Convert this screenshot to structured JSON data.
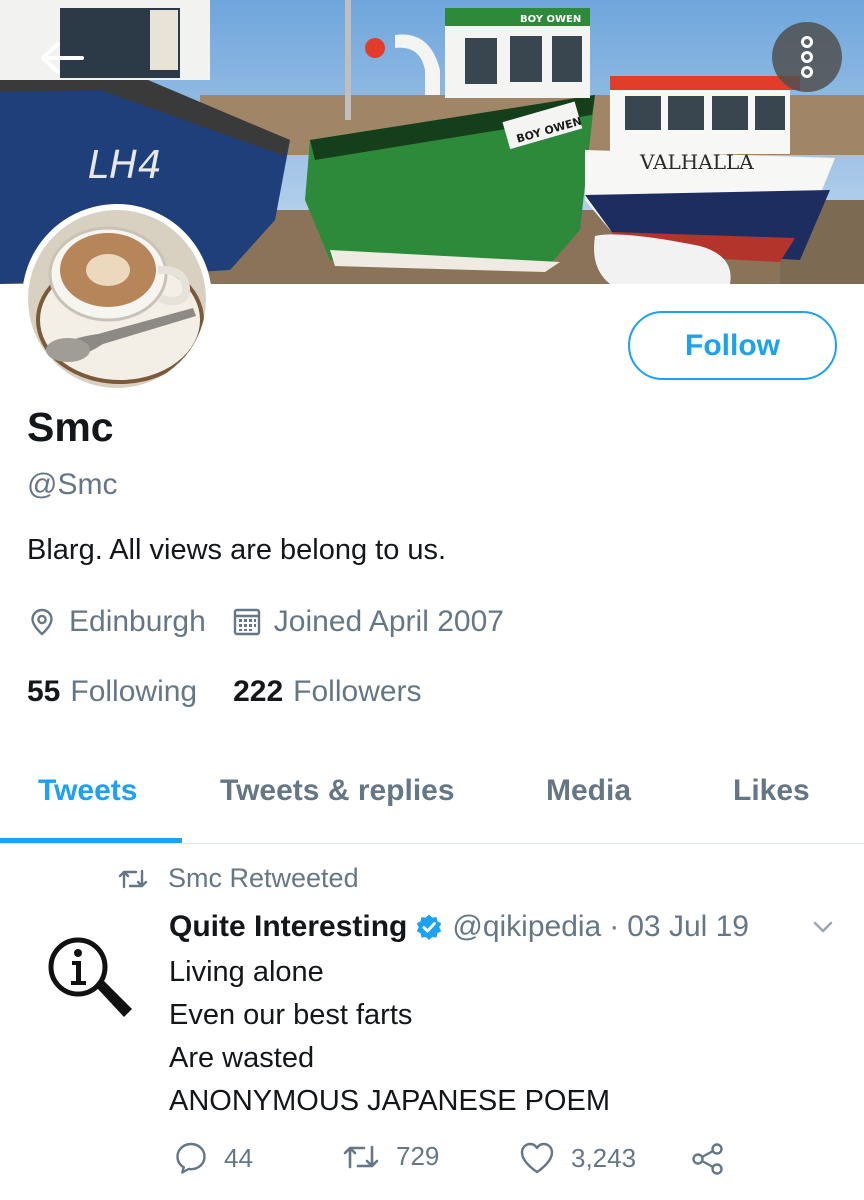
{
  "banner": {
    "boats": [
      {
        "name_hull": "LH4"
      },
      {
        "name_cabin": "BOY OWEN",
        "name_bow": "BOY OWEN"
      },
      {
        "name_hull": "VALHALLA"
      }
    ]
  },
  "header": {
    "back_icon": "arrow-left-icon",
    "more_icon": "more-options-icon"
  },
  "profile": {
    "display_name": "Smc",
    "handle": "@Smc",
    "bio": "Blarg. All views are belong to us.",
    "follow_label": "Follow",
    "location": "Edinburgh",
    "joined": "Joined April 2007",
    "following_count": "55",
    "following_label": "Following",
    "followers_count": "222",
    "followers_label": "Followers"
  },
  "tabs": [
    {
      "label": "Tweets",
      "active": true
    },
    {
      "label": "Tweets & replies",
      "active": false
    },
    {
      "label": "Media",
      "active": false
    },
    {
      "label": "Likes",
      "active": false
    }
  ],
  "tweet": {
    "retweet_context": "Smc Retweeted",
    "author": "Quite Interesting",
    "verified": true,
    "handle": "@qikipedia",
    "separator": "·",
    "date": "03 Jul 19",
    "lines": [
      "Living alone",
      "Even our best farts",
      "Are wasted",
      "ANONYMOUS JAPANESE POEM"
    ],
    "replies": "44",
    "retweets": "729",
    "likes": "3,243"
  },
  "colors": {
    "accent": "#1da1f2",
    "muted": "#657786",
    "text": "#14171a",
    "divider": "#e1e8ed"
  }
}
